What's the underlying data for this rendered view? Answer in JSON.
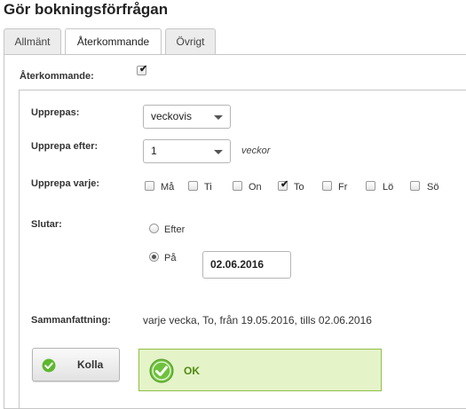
{
  "page": {
    "title": "Gör bokningsförfrågan"
  },
  "tabs": [
    {
      "label": "Allmänt",
      "active": false
    },
    {
      "label": "Återkommande",
      "active": true
    },
    {
      "label": "Övrigt",
      "active": false
    }
  ],
  "recurring": {
    "label": "Återkommande:",
    "checked": true
  },
  "repeat": {
    "label": "Upprepas:",
    "value": "veckovis"
  },
  "repeat_after": {
    "label": "Upprepa efter:",
    "value": "1",
    "unit": "veckor"
  },
  "repeat_every": {
    "label": "Upprepa varje:",
    "days": [
      {
        "label": "Må",
        "checked": false
      },
      {
        "label": "Ti",
        "checked": false
      },
      {
        "label": "On",
        "checked": false
      },
      {
        "label": "To",
        "checked": true
      },
      {
        "label": "Fr",
        "checked": false
      },
      {
        "label": "Lö",
        "checked": false
      },
      {
        "label": "Sö",
        "checked": false
      }
    ]
  },
  "ends": {
    "label": "Slutar:",
    "options": [
      {
        "label": "Efter",
        "selected": false
      },
      {
        "label": "På",
        "selected": true
      }
    ],
    "date_value": "02.06.2016"
  },
  "summary": {
    "label": "Sammanfattning:",
    "text": "varje vecka, To, från 19.05.2016, tills 02.06.2016"
  },
  "actions": {
    "check_label": "Kolla",
    "status_label": "OK"
  },
  "colors": {
    "ok_green": "#5cb82e",
    "ok_bg": "#e5f3c9"
  }
}
